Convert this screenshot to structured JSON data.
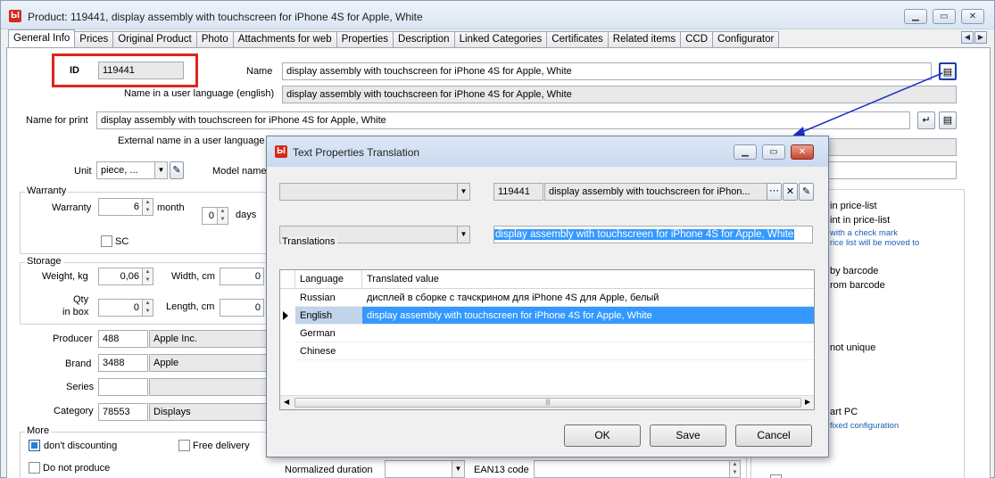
{
  "window": {
    "title": "Product: 119441, display assembly with touchscreen for iPhone 4S for Apple, White",
    "icon": "app-logo-icon"
  },
  "tabs": [
    "General Info",
    "Prices",
    "Original Product",
    "Photo",
    "Attachments for web",
    "Properties",
    "Description",
    "Linked Categories",
    "Certificates",
    "Related items",
    "CCD",
    "Configurator"
  ],
  "general": {
    "id_label": "ID",
    "id_value": "119441",
    "name_label": "Name",
    "name_value": "display assembly with touchscreen for iPhone 4S for Apple, White",
    "name_user_lang_label": "Name in a user language (english)",
    "name_user_lang_value": "display assembly with touchscreen for iPhone 4S for Apple, White",
    "name_print_label": "Name for print",
    "name_print_value": "display assembly with touchscreen for iPhone 4S for Apple, White",
    "ext_name_label": "External name in a user language",
    "unit_label": "Unit",
    "unit_value": "piece, ...",
    "model_label": "Model name"
  },
  "warranty": {
    "group": "Warranty",
    "label": "Warranty",
    "value": "6",
    "unit": "month",
    "days_value": "0",
    "days_label": "days",
    "sc_label": "SC"
  },
  "storage": {
    "group": "Storage",
    "weight_label": "Weight, kg",
    "weight_value": "0,06",
    "width_label": "Width, cm",
    "width_value": "0",
    "qty_label_1": "Qty",
    "qty_label_2": "in box",
    "qty_value": "0",
    "length_label": "Length, cm",
    "length_value": "0"
  },
  "producer": {
    "label": "Producer",
    "code": "488",
    "name": "Apple Inc."
  },
  "brand": {
    "label": "Brand",
    "code": "3488",
    "name": "Apple"
  },
  "series": {
    "label": "Series",
    "code": "",
    "name": ""
  },
  "category": {
    "label": "Category",
    "code": "78553",
    "name": "Displays"
  },
  "more": {
    "group": "More",
    "dont_discounting": "don't discounting",
    "free_delivery": "Free delivery",
    "do_not_produce": "Do not produce",
    "normalized_duration": "Normalized duration",
    "ean13": "EAN13 code"
  },
  "right": {
    "price_list": "in price-list",
    "print_price_list": "int in price-list",
    "check_mark": "with a check mark",
    "moved": "rice list will be moved to",
    "by_barcode": "by barcode",
    "from_barcode": "rom barcode",
    "not_unique": "not unique",
    "art_pc": "art PC",
    "fixed_config": "fixed configuration"
  },
  "dialog": {
    "title": "Text Properties Translation",
    "id_value": "119441",
    "text_value": "display assembly with touchscreen for iPhon...",
    "translations_label": "Translations",
    "selected_text": "display assembly with touchscreen for iPhone 4S for Apple, White",
    "columns": [
      "Language",
      "Translated value"
    ],
    "rows": [
      {
        "language": "Russian",
        "value": "дисплей в сборке с тачскрином для iPhone 4S для Apple, белый"
      },
      {
        "language": "English",
        "value": "display assembly with touchscreen for iPhone 4S for Apple, White"
      },
      {
        "language": "German",
        "value": ""
      },
      {
        "language": "Chinese",
        "value": ""
      }
    ],
    "ok": "OK",
    "save": "Save",
    "cancel": "Cancel"
  }
}
